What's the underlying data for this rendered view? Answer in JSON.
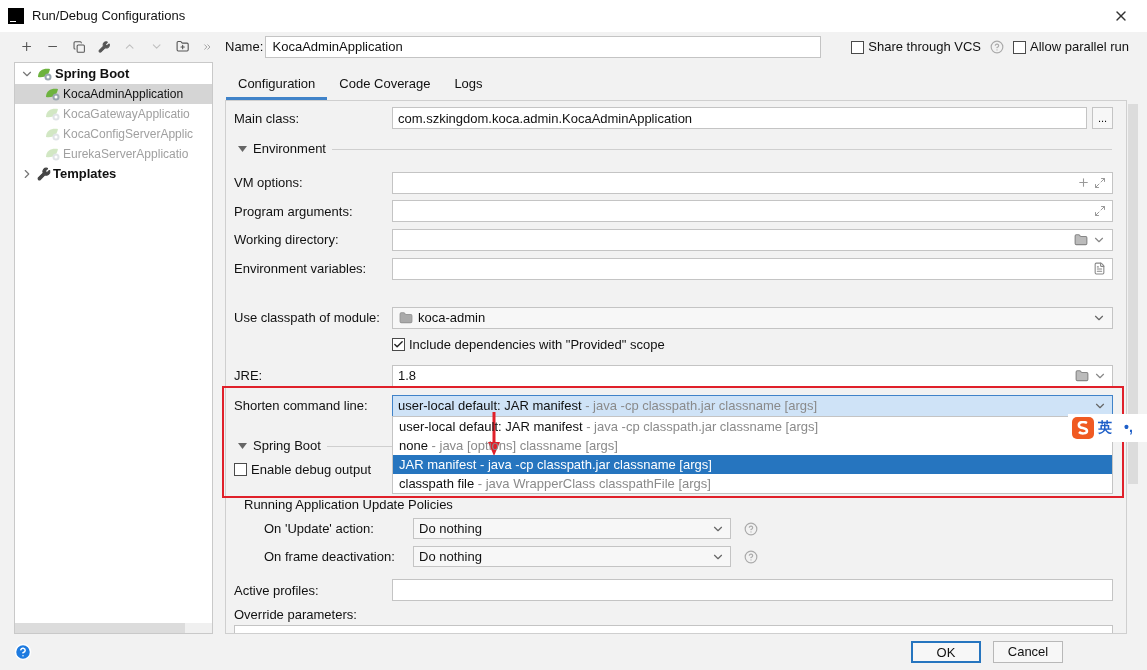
{
  "window": {
    "title": "Run/Debug Configurations"
  },
  "tree": [
    {
      "label": "Spring Boot",
      "expanded": true,
      "selected": false,
      "dimmed": false,
      "kind": "spring",
      "children": [
        {
          "label": "KocaAdminApplication",
          "selected": true,
          "dimmed": false,
          "kind": "app"
        },
        {
          "label": "KocaGatewayApplicatio",
          "selected": false,
          "dimmed": true,
          "kind": "app"
        },
        {
          "label": "KocaConfigServerApplic",
          "selected": false,
          "dimmed": true,
          "kind": "app"
        },
        {
          "label": "EurekaServerApplicatio",
          "selected": false,
          "dimmed": true,
          "kind": "app"
        }
      ]
    },
    {
      "label": "Templates",
      "expanded": false,
      "selected": false,
      "dimmed": false,
      "kind": "templates"
    }
  ],
  "name": {
    "label": "Name:",
    "value": "KocaAdminApplication"
  },
  "options": [
    {
      "label": "Share through VCS",
      "checked": false,
      "help": true
    },
    {
      "label": "Allow parallel run",
      "checked": false,
      "help": false
    }
  ],
  "tabs": [
    {
      "label": "Configuration",
      "selected": true
    },
    {
      "label": "Code Coverage",
      "selected": false
    },
    {
      "label": "Logs",
      "selected": false
    }
  ],
  "form": {
    "main_class": {
      "label": "Main class:",
      "value": "com.szkingdom.koca.admin.KocaAdminApplication",
      "browse": "..."
    },
    "environment": {
      "title": "Environment",
      "expanded": true,
      "fields": [
        {
          "label": "VM options:",
          "kind": "vm"
        },
        {
          "label": "Program arguments:",
          "kind": "args"
        },
        {
          "label": "Working directory:",
          "kind": "dir"
        },
        {
          "label": "Environment variables:",
          "kind": "env"
        }
      ]
    },
    "module": {
      "label": "Use classpath of module:",
      "value": "koca-admin"
    },
    "include_provided": {
      "label": "Include dependencies with \"Provided\" scope",
      "checked": true
    },
    "jre": {
      "label": "JRE:",
      "value": "1.8"
    },
    "shorten": {
      "label": "Shorten command line:",
      "main": "user-local default: JAR manifest",
      "hint": "- java -cp classpath.jar classname [args]",
      "expanded": true,
      "options": [
        {
          "main": "user-local default: JAR manifest",
          "hint": "- java -cp classpath.jar classname [args]",
          "selected": false
        },
        {
          "main": "none",
          "hint": "- java [options] classname [args]",
          "selected": false
        },
        {
          "main": "JAR manifest",
          "hint": "- java -cp classpath.jar classname [args]",
          "selected": true
        },
        {
          "main": "classpath file",
          "hint": "- java WrapperClass classpathFile [args]",
          "selected": false
        }
      ]
    },
    "spring_boot": {
      "title": "Spring Boot",
      "expanded": true,
      "debug": {
        "label": "Enable debug output",
        "checked": false
      }
    },
    "policies": {
      "title": "Running Application Update Policies",
      "rows": [
        {
          "label": "On 'Update' action:",
          "value": "Do nothing"
        },
        {
          "label": "On frame deactivation:",
          "value": "Do nothing"
        }
      ]
    },
    "active_profiles": {
      "label": "Active profiles:"
    },
    "override": {
      "label": "Override parameters:"
    }
  },
  "ime": {
    "mode": "英",
    "punct": "•,"
  },
  "buttons": [
    {
      "label": "OK",
      "default": true
    },
    {
      "label": "Cancel",
      "default": false
    }
  ]
}
